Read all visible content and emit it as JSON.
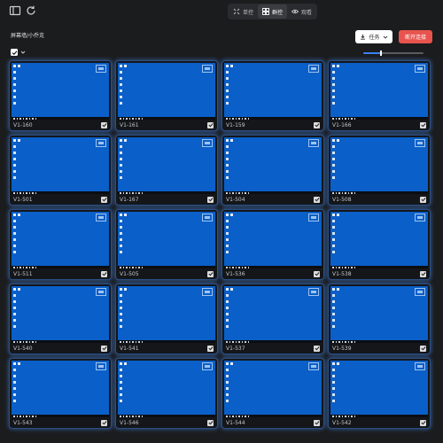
{
  "toolbar": {
    "modes": [
      {
        "label": "单控",
        "icon": "single-control-icon",
        "active": false
      },
      {
        "label": "群控",
        "icon": "group-control-icon",
        "active": true
      },
      {
        "label": "观看",
        "icon": "eye-icon",
        "active": false
      }
    ]
  },
  "page": {
    "title": "屏幕墙/小乔克",
    "task_label": "任务",
    "disconnect_label": "断开连接"
  },
  "zoom": {
    "level": 0.3
  },
  "devices": [
    {
      "name": "V1-160"
    },
    {
      "name": "V1-161"
    },
    {
      "name": "V1-159"
    },
    {
      "name": "V1-166"
    },
    {
      "name": "V1-501"
    },
    {
      "name": "V1-167"
    },
    {
      "name": "V1-504"
    },
    {
      "name": "V1-508"
    },
    {
      "name": "V1-511"
    },
    {
      "name": "V1-505"
    },
    {
      "name": "V1-536"
    },
    {
      "name": "V1-538"
    },
    {
      "name": "V1-540"
    },
    {
      "name": "V1-541"
    },
    {
      "name": "V1-537"
    },
    {
      "name": "V1-539"
    },
    {
      "name": "V1-543"
    },
    {
      "name": "V1-546"
    },
    {
      "name": "V1-544"
    },
    {
      "name": "V1-542"
    }
  ],
  "colors": {
    "accent": "#3b82f6",
    "danger": "#e9534e",
    "screen": "#0a5fc8"
  }
}
